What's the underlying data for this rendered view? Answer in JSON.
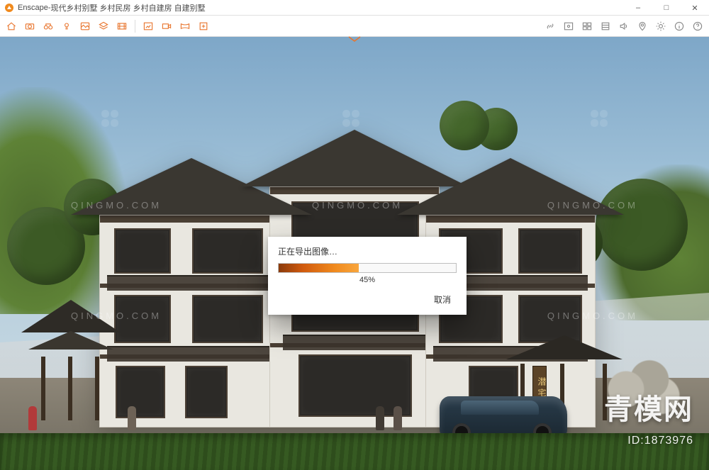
{
  "window": {
    "app_name": "Enscape",
    "title_sep": " - ",
    "document_title": "现代乡村别墅 乡村民房 乡村自建房 自建别墅",
    "controls": {
      "minimize": "–",
      "maximize": "□",
      "close": "✕"
    }
  },
  "toolbar": {
    "left_group_icons": [
      "home-icon",
      "camera-icon",
      "binoculars-icon",
      "light-icon",
      "scene-icon",
      "layers-icon",
      "film-icon"
    ],
    "mid_group_icons": [
      "export-image-icon",
      "export-video-icon",
      "export-pano-icon",
      "export-exe-icon"
    ],
    "right_group_icons": [
      "link-icon",
      "image-settings-icon",
      "asset-library-icon",
      "visual-settings-icon",
      "sound-icon",
      "map-pin-icon",
      "sliders-icon",
      "info-icon",
      "help-icon"
    ]
  },
  "dialog": {
    "title": "正在导出图像…",
    "percent_value": 45,
    "percent_label": "45%",
    "cancel_label": "取消"
  },
  "scene": {
    "plaque_text": "潜宅"
  },
  "watermark": {
    "text": "QINGMO.COM",
    "brand": "青模网",
    "id_label": "ID:1873976"
  }
}
